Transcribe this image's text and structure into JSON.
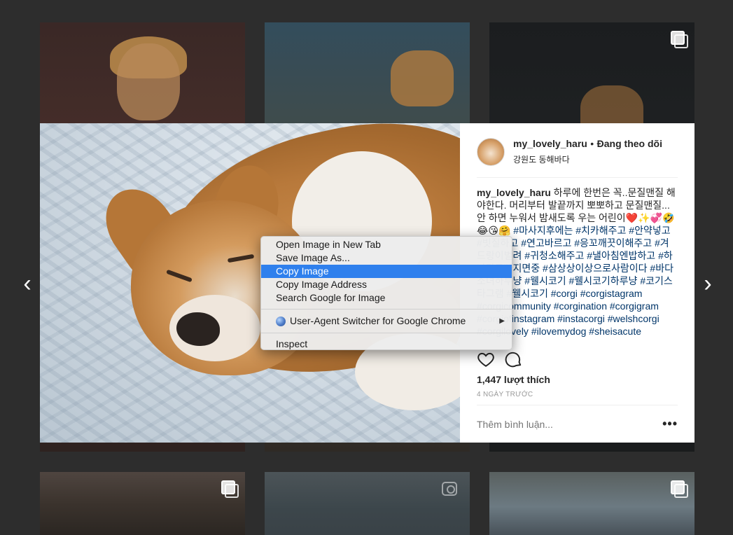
{
  "navigation": {
    "prev_arrow": "‹",
    "next_arrow": "›"
  },
  "post": {
    "username": "my_lovely_haru",
    "separator": "•",
    "follow_status": "Đang theo dõi",
    "location": "강원도 동해바다",
    "caption_text": "하루에 한번은 꼭..문질맨질 해야한다. 머리부터 발끝까지 뽀뽀하고 문질맨질... 안 하면 누워서 밤새도록 우는 어린이❤️✨💞🤣😂😘🤗",
    "hashtags": "#마사지후에는 #치카해주고 #안약넣고 #빗질하고 #연고바르고 #응꼬깨끗이해주고 #겨드랑이벌려 #귀청소해주고 #낼아침엔밥하고 #하나라도빠지면중 #삼상상이상으로사람이다 #바다소녀하루냥 #웰시코기 #웰시코기하루냥 #코기스타그램 #웰시코기 #corgi #corgistagram #corgicommunity #corgination #corgigram #corgiofinstagram #instacorgi #welshcorgi #corgilovely #ilovemydog #sheisacute",
    "likes": "1,447 lượt thích",
    "timestamp": "4 NGÀY TRƯỚC",
    "comment_placeholder": "Thêm bình luận...",
    "more_glyph": "•••"
  },
  "context_menu": {
    "items": [
      {
        "label": "Open Image in New Tab"
      },
      {
        "label": "Save Image As..."
      },
      {
        "label": "Copy Image",
        "active": true
      },
      {
        "label": "Copy Image Address"
      },
      {
        "label": "Search Google for Image"
      }
    ],
    "extension": {
      "label": "User-Agent Switcher for Google Chrome",
      "icon": "globe-icon",
      "arrow": "▶"
    },
    "inspect": {
      "label": "Inspect"
    }
  },
  "icons": {
    "like": "heart-icon",
    "comment": "comment-icon",
    "multi_post": "multiple-photos-icon",
    "camera": "camera-icon"
  },
  "colors": {
    "backdrop": "#2d2d2d",
    "menu_highlight": "#2f80ed",
    "hashtag_link": "#003569",
    "text": "#262626",
    "muted": "#999999"
  }
}
